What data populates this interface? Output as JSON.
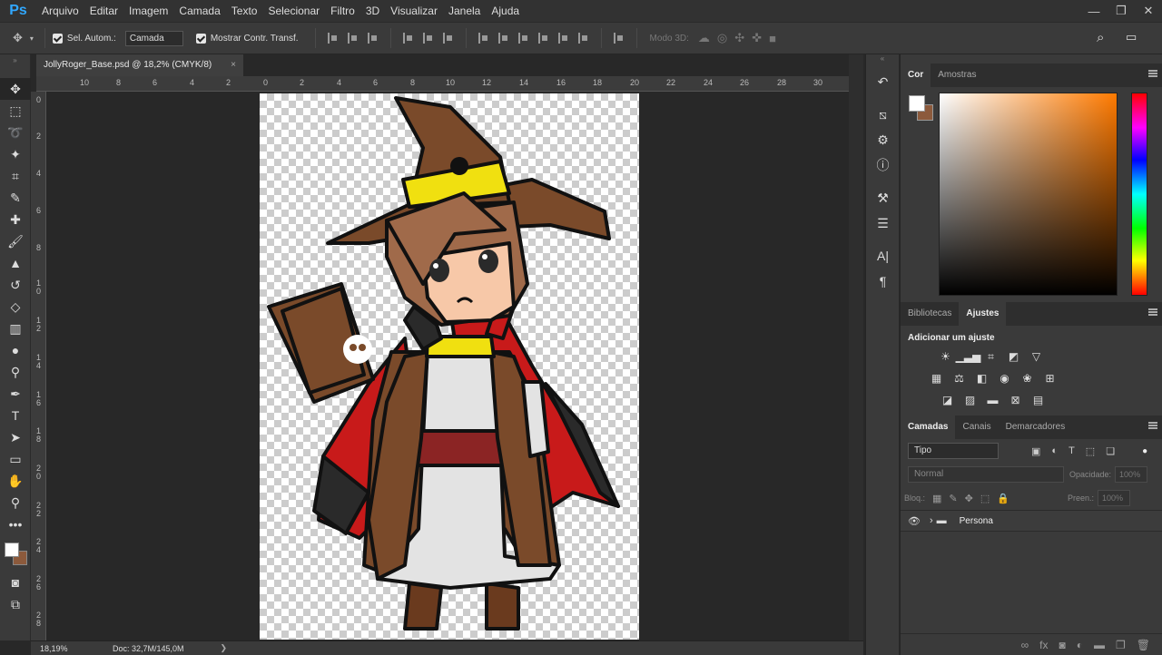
{
  "app": {
    "logo": "Ps"
  },
  "menu": [
    "Arquivo",
    "Editar",
    "Imagem",
    "Camada",
    "Texto",
    "Selecionar",
    "Filtro",
    "3D",
    "Visualizar",
    "Janela",
    "Ajuda"
  ],
  "window_controls": {
    "minimize": "—",
    "restore": "❐",
    "close": "✕"
  },
  "options_bar": {
    "auto_select_label": "Sel. Autom.:",
    "auto_select_value": "Camada",
    "show_transform_label": "Mostrar Contr. Transf.",
    "mode3d_label": "Modo 3D:"
  },
  "document": {
    "tab_title": "JollyRoger_Base.psd @ 18,2% (CMYK/8)",
    "close": "×"
  },
  "rulers": {
    "h_labels": [
      "10",
      "8",
      "6",
      "4",
      "2",
      "0",
      "2",
      "4",
      "6",
      "8",
      "10",
      "12",
      "14",
      "16",
      "18",
      "20",
      "22",
      "24",
      "26",
      "28",
      "30"
    ],
    "v_labels": [
      "0",
      "2",
      "4",
      "6",
      "8",
      "1 0",
      "1 2",
      "1 4",
      "1 6",
      "1 8",
      "2 0",
      "2 2",
      "2 4",
      "2 6",
      "2 8"
    ]
  },
  "status": {
    "zoom": "18,19%",
    "doc_info": "Doc: 32,7M/145,0M",
    "arrow": "❯"
  },
  "colors": {
    "foreground": "#ffffff",
    "background": "#8c5a3c",
    "accent": "#31a8ff"
  },
  "color_panel": {
    "tabs": [
      "Cor",
      "Amostras"
    ]
  },
  "adjust_panel": {
    "tabs": [
      "Bibliotecas",
      "Ajustes"
    ],
    "title": "Adicionar um ajuste"
  },
  "layers_panel": {
    "tabs": [
      "Camadas",
      "Canais",
      "Demarcadores"
    ],
    "filter_kind": "Tipo",
    "blend_mode": "Normal",
    "opacity_label": "Opacidade:",
    "opacity_value": "100%",
    "lock_label": "Bloq.:",
    "fill_label": "Preen.:",
    "fill_value": "100%",
    "layers": [
      {
        "name": "Persona",
        "type": "group",
        "visible": true
      }
    ]
  }
}
